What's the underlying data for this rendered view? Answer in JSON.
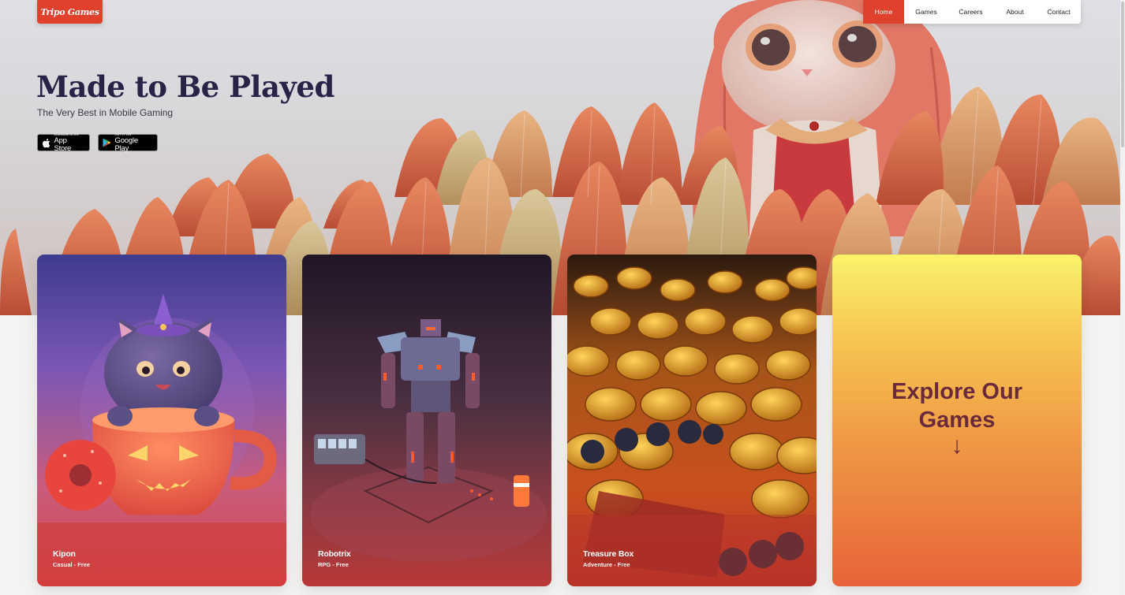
{
  "brand": {
    "logo_text": "Tripo Games",
    "accent": "#e0412d"
  },
  "nav": {
    "items": [
      {
        "label": "Home",
        "active": true
      },
      {
        "label": "Games"
      },
      {
        "label": "Careers"
      },
      {
        "label": "About"
      },
      {
        "label": "Contact"
      }
    ]
  },
  "hero": {
    "title": "Made to Be Played",
    "subtitle": "The Very Best in Mobile Gaming",
    "app_store": {
      "small": "Download on the",
      "big": "App Store",
      "icon": "apple-icon"
    },
    "google_play": {
      "small": "GET IT ON",
      "big": "Google Play",
      "icon": "google-play-icon"
    }
  },
  "games": [
    {
      "title": "Kipon",
      "subtitle": "Casual - Free"
    },
    {
      "title": "Robotrix",
      "subtitle": "RPG - Free"
    },
    {
      "title": "Treasure Box",
      "subtitle": "Adventure - Free"
    }
  ],
  "explore": {
    "label": "Explore Our Games",
    "arrow": "↓"
  }
}
